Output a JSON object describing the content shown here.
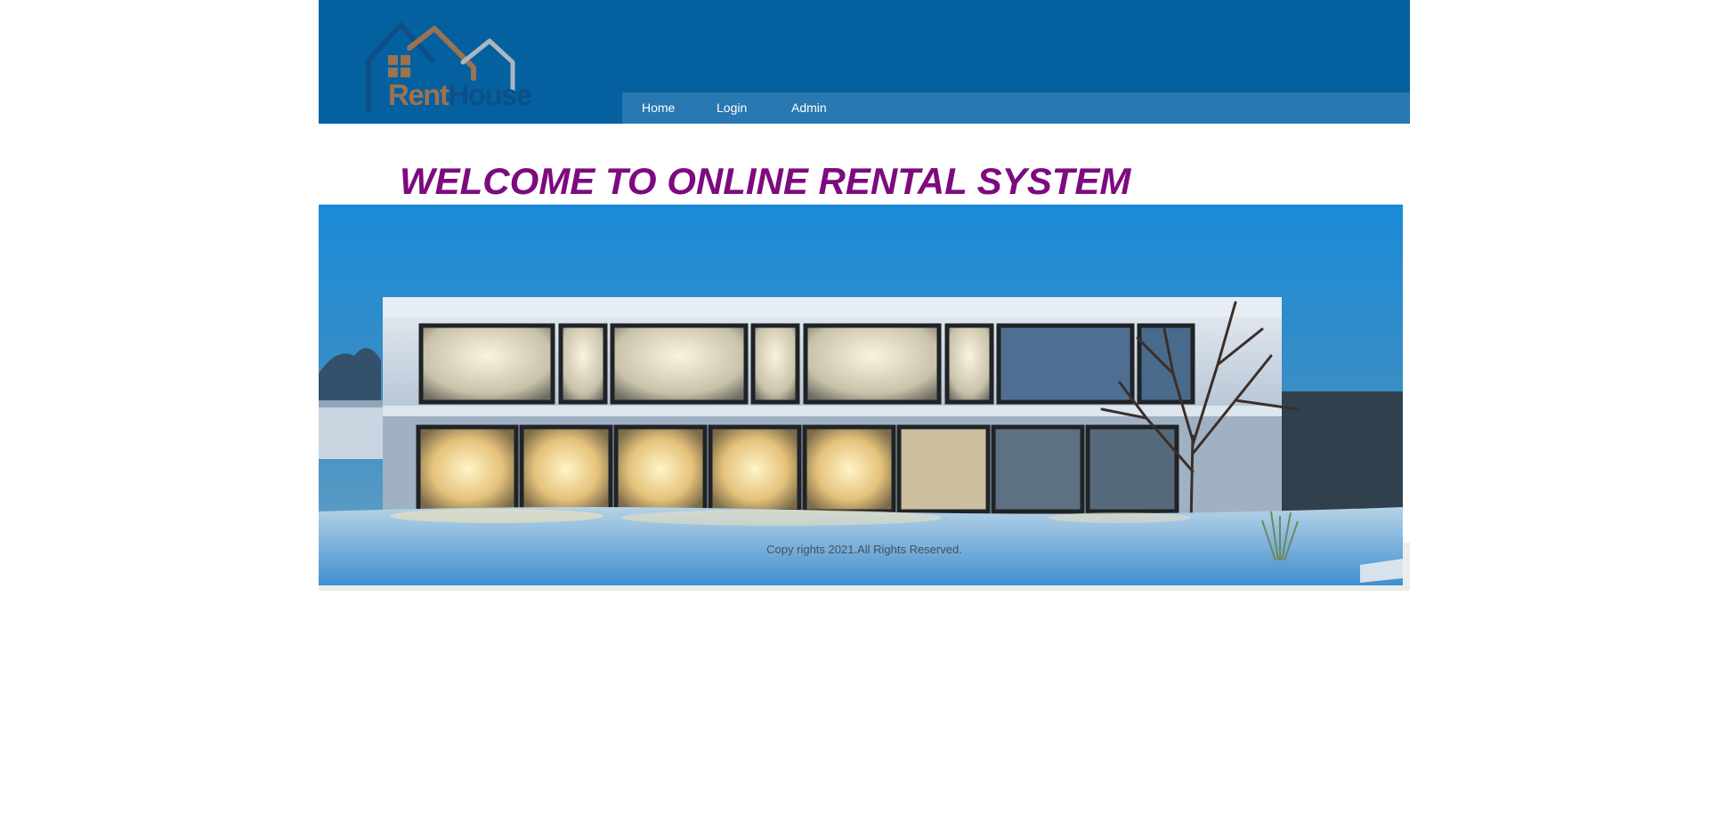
{
  "brand": {
    "logo_word_1": "Rent",
    "logo_word_2": "House",
    "colors": {
      "header": "#0560a0",
      "navbar": "#2878b1",
      "logo_rent": "#a8754a",
      "logo_house": "#0d4f85"
    }
  },
  "nav": {
    "items": [
      {
        "label": "Home"
      },
      {
        "label": "Login"
      },
      {
        "label": "Admin"
      }
    ]
  },
  "main": {
    "welcome_heading": "WELCOME TO ONLINE RENTAL SYSTEM",
    "heading_color": "#7d0a7f",
    "hero_image": "modern-house-at-dusk-image"
  },
  "footer": {
    "copyright": "Copy rights 2021.All Rights Reserved."
  }
}
